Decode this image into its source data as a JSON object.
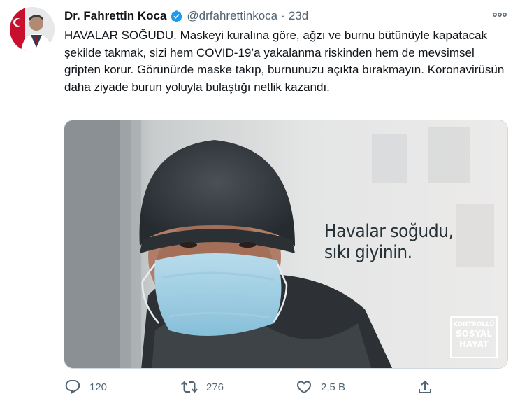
{
  "tweet": {
    "display_name": "Dr. Fahrettin Koca",
    "handle": "@drfahrettinkoca",
    "separator": "·",
    "time": "23d",
    "text": "HAVALAR SOĞUDU. Maskeyi kuralına göre, ağzı ve burnu bütünüyle kapatacak şekilde takmak, sizi hem COVID-19’a yakalanma riskinden hem de mevsimsel gripten korur. Görünürde maske takıp, burnunuzu açıkta bırakmayın. Koronavirüsün daha ziyade burun yoluyla bulaştığı netlik kazandı.",
    "verified": true
  },
  "media": {
    "overlay_line1": "Havalar soğudu,",
    "overlay_line2": "sıkı giyinin.",
    "logo": {
      "line1": "KONTROLLÜ",
      "line2": "SOSYAL",
      "line3": "HAYAT"
    }
  },
  "actions": {
    "reply_count": "120",
    "retweet_count": "276",
    "like_count": "2,5 B"
  },
  "icons": {
    "verified": "verified-badge-icon",
    "more": "more-options-icon",
    "reply": "reply-icon",
    "retweet": "retweet-icon",
    "like": "like-icon",
    "share": "share-icon"
  },
  "colors": {
    "accent": "#1d9bf0",
    "text": "#0f1419",
    "secondary": "#536471"
  }
}
